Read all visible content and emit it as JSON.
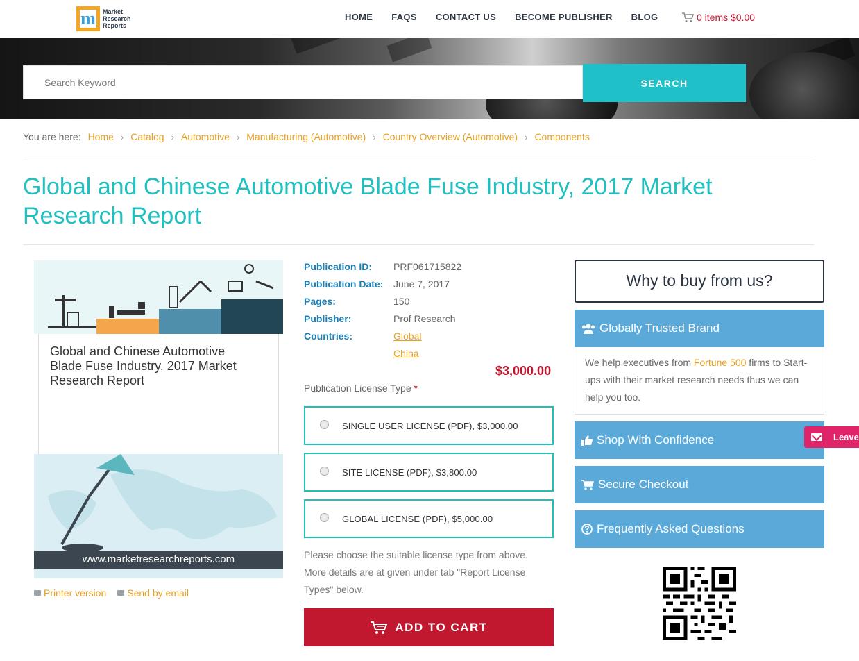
{
  "brand": {
    "logo_letter": "m",
    "logo_lines": [
      "Market",
      "Research",
      "Reports"
    ]
  },
  "nav": {
    "items": [
      {
        "label": "HOME"
      },
      {
        "label": "FAQS"
      },
      {
        "label": "CONTACT US"
      },
      {
        "label": "BECOME PUBLISHER"
      },
      {
        "label": "BLOG"
      }
    ],
    "cart_label": "0 items $0.00"
  },
  "search": {
    "placeholder": "Search Keyword",
    "button_label": "SEARCH"
  },
  "breadcrumb": {
    "label": "You are here:",
    "items": [
      "Home",
      "Catalog",
      "Automotive",
      "Manufacturing (Automotive)",
      "Country Overview (Automotive)",
      "Components"
    ]
  },
  "page_title": "Global and Chinese Automotive Blade Fuse Industry, 2017 Market Research Report",
  "cover": {
    "title": "Global and Chinese Automotive Blade Fuse Industry, 2017 Market Research Report",
    "url": "www.marketresearchreports.com",
    "printer_label": "Printer version",
    "email_label": "Send by email"
  },
  "details": {
    "publication_id_label": "Publication ID:",
    "publication_id": "PRF061715822",
    "publication_date_label": "Publication Date:",
    "publication_date": "June 7, 2017",
    "pages_label": "Pages:",
    "pages": "150",
    "publisher_label": "Publisher:",
    "publisher": "Prof Research",
    "countries_label": "Countries:",
    "countries": [
      "Global",
      "China"
    ]
  },
  "price": "$3,000.00",
  "license": {
    "type_label": "Publication License Type",
    "required_mark": "*",
    "options": [
      {
        "label": "SINGLE USER LICENSE (PDF), $3,000.00"
      },
      {
        "label": "SITE LICENSE (PDF), $3,800.00"
      },
      {
        "label": "GLOBAL LICENSE (PDF), $5,000.00"
      }
    ],
    "note": "Please choose the suitable license type from above. More details are at given under tab \"Report License Types\" below."
  },
  "add_to_cart_label": "ADD TO CART",
  "sidebar": {
    "why_title": "Why to buy from us?",
    "trusted_title": "Globally Trusted Brand",
    "trusted_text_before": "We help executives from ",
    "trusted_link": "Fortune 500",
    "trusted_text_after": " firms to Start-ups with their market research needs thus we can help you too.",
    "shop_title": "Shop With Confidence",
    "checkout_title": "Secure Checkout",
    "faq_title": "Frequently Asked Questions"
  },
  "leave_tab": "Leave",
  "colors": {
    "accent": "#20c0c8",
    "title": "#20bfc0",
    "link": "#e8a020",
    "price": "#c0182f",
    "panel": "#5ba9d9",
    "cart_button": "#c1182f",
    "leave_tab": "#e0246a"
  }
}
